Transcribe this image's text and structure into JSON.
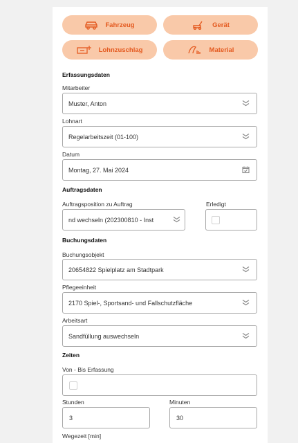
{
  "buttons": {
    "fahrzeug": "Fahrzeug",
    "geraet": "Gerät",
    "lohnzuschlag": "Lohnzuschlag",
    "material": "Material"
  },
  "erfassung": {
    "title": "Erfassungsdaten",
    "mitarbeiter_label": "Mitarbeiter",
    "mitarbeiter_value": "Muster, Anton",
    "lohnart_label": "Lohnart",
    "lohnart_value": "Regelarbeitszeit (01-100)",
    "datum_label": "Datum",
    "datum_value": "Montag, 27. Mai 2024"
  },
  "auftrag": {
    "title": "Auftragsdaten",
    "position_label": "Auftragsposition zu Auftrag",
    "position_value": "nd wechseln (202300810 - Inst",
    "erledigt_label": "Erledigt"
  },
  "buchung": {
    "title": "Buchungsdaten",
    "objekt_label": "Buchungsobjekt",
    "objekt_value": "20654822 Spielplatz am Stadtpark",
    "pflege_label": "Pflegeeinheit",
    "pflege_value": "2170 Spiel-, Sportsand- und Fallschutzfläche",
    "arbeitsart_label": "Arbeitsart",
    "arbeitsart_value": "Sandfüllung auswechseln"
  },
  "zeiten": {
    "title": "Zeiten",
    "vonbis_label": "Von - Bis Erfassung",
    "stunden_label": "Stunden",
    "stunden_value": "3",
    "minuten_label": "Minuten",
    "minuten_value": "30",
    "wegezeit_label": "Wegezeit [min]"
  },
  "colors": {
    "accent": "#e45a20",
    "button_bg": "#f9c9a9",
    "border": "#a7a7a7"
  },
  "icons": {
    "fahrzeug": "car-icon",
    "geraet": "mower-icon",
    "lohnzuschlag": "money-plus-icon",
    "material": "material-icon",
    "dropdown": "double-chevron-down-icon",
    "datum": "calendar-icon"
  }
}
